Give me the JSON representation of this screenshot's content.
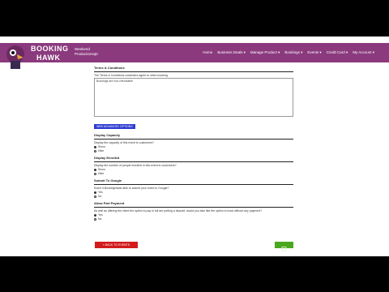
{
  "brand": {
    "line1": "BOOKING",
    "line2": "HAWK"
  },
  "user": {
    "line1": "Weekend",
    "line2": "Productionsqtr"
  },
  "nav": [
    "Home",
    "Business Deals ▾",
    "Manage Product ▾",
    "Bookings ▾",
    "Events ▾",
    "Credit Card ▾",
    "My Account ▾"
  ],
  "terms": {
    "heading": "Terms & Conditions",
    "prompt": "The Terms & Conditions customers agree to when booking",
    "box_text": "Bookings are non-refundable"
  },
  "badge": "WBS ADVANCED OPTIONS",
  "options": [
    {
      "heading": "Display Capacity",
      "question": "Display the capacity of this event to customers?",
      "choices": [
        "Show",
        "Hide"
      ],
      "selected": 0
    },
    {
      "heading": "Display Enrolled",
      "question": "Display the number of people enrolled in this event to customers?",
      "choices": [
        "Show",
        "Hide"
      ],
      "selected": 0
    },
    {
      "heading": "Submit To Google",
      "question": "Some it BookingHawk able to submit your event to Google?",
      "choices": [
        "Yes",
        "No"
      ],
      "selected": 0
    },
    {
      "heading": "Allow Part Payment",
      "question": "As well as offering the client the option to pay in full are putting a deposit, would you also like the option to book without any payment?",
      "choices": [
        "Yes",
        "No"
      ],
      "selected": 0
    }
  ],
  "buttons": {
    "red": "« BACK TO EVENTS"
  },
  "colors": {
    "topbar": "#8b3a7e",
    "badge": "#2d3bd0",
    "danger": "#d21b1b",
    "success": "#49a81e"
  }
}
